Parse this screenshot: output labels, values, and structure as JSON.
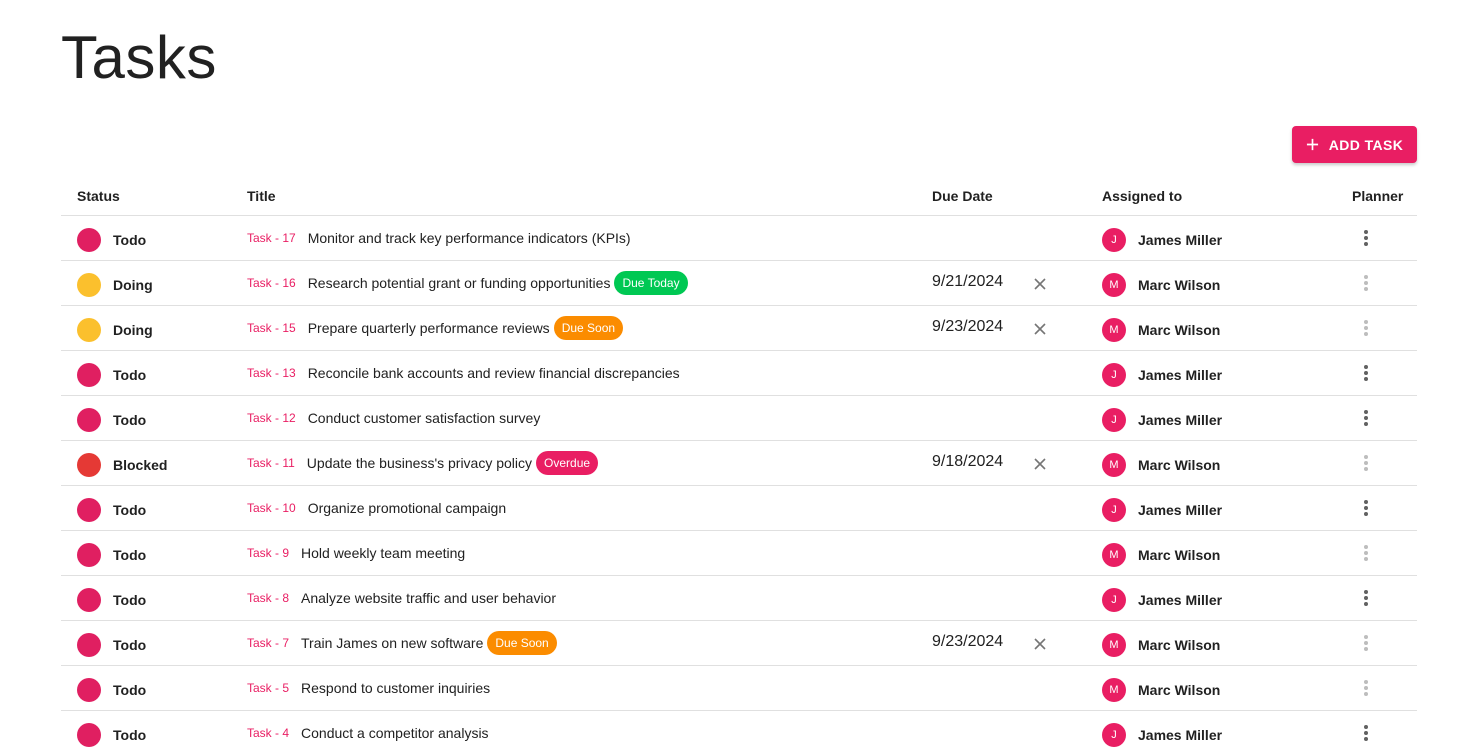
{
  "page": {
    "title": "Tasks",
    "add_button_label": "ADD TASK"
  },
  "colors": {
    "accent": "#e91e63",
    "todo": "#e01f61",
    "doing": "#fbc02d",
    "blocked": "#e53935",
    "due_today": "#00c853",
    "due_soon": "#fb8c00",
    "overdue": "#e91e63",
    "menu_active": "#616161",
    "menu_inactive": "#bdbdbd"
  },
  "table": {
    "headers": {
      "status": "Status",
      "title": "Title",
      "due_date": "Due Date",
      "assigned_to": "Assigned to",
      "planner": "Planner"
    },
    "rows": [
      {
        "status": "Todo",
        "status_color": "#e01f61",
        "task_id": "Task - 17",
        "title": "Monitor and track key performance indicators (KPIs)",
        "badge": "",
        "badge_color": "",
        "due_date": "",
        "clearable": false,
        "avatar": "J",
        "assignee": "James Miller",
        "menu_active": true
      },
      {
        "status": "Doing",
        "status_color": "#fbc02d",
        "task_id": "Task - 16",
        "title": "Research potential grant or funding opportunities",
        "badge": "Due Today",
        "badge_color": "#00c853",
        "due_date": "9/21/2024",
        "clearable": true,
        "avatar": "M",
        "assignee": "Marc Wilson",
        "menu_active": false
      },
      {
        "status": "Doing",
        "status_color": "#fbc02d",
        "task_id": "Task - 15",
        "title": "Prepare quarterly performance reviews",
        "badge": "Due Soon",
        "badge_color": "#fb8c00",
        "due_date": "9/23/2024",
        "clearable": true,
        "avatar": "M",
        "assignee": "Marc Wilson",
        "menu_active": false
      },
      {
        "status": "Todo",
        "status_color": "#e01f61",
        "task_id": "Task - 13",
        "title": "Reconcile bank accounts and review financial discrepancies",
        "badge": "",
        "badge_color": "",
        "due_date": "",
        "clearable": false,
        "avatar": "J",
        "assignee": "James Miller",
        "menu_active": true
      },
      {
        "status": "Todo",
        "status_color": "#e01f61",
        "task_id": "Task - 12",
        "title": "Conduct customer satisfaction survey",
        "badge": "",
        "badge_color": "",
        "due_date": "",
        "clearable": false,
        "avatar": "J",
        "assignee": "James Miller",
        "menu_active": true
      },
      {
        "status": "Blocked",
        "status_color": "#e53935",
        "task_id": "Task - 11",
        "title": "Update the business's privacy policy",
        "badge": "Overdue",
        "badge_color": "#e91e63",
        "due_date": "9/18/2024",
        "clearable": true,
        "avatar": "M",
        "assignee": "Marc Wilson",
        "menu_active": false
      },
      {
        "status": "Todo",
        "status_color": "#e01f61",
        "task_id": "Task - 10",
        "title": "Organize promotional campaign",
        "badge": "",
        "badge_color": "",
        "due_date": "",
        "clearable": false,
        "avatar": "J",
        "assignee": "James Miller",
        "menu_active": true
      },
      {
        "status": "Todo",
        "status_color": "#e01f61",
        "task_id": "Task - 9",
        "title": "Hold weekly team meeting",
        "badge": "",
        "badge_color": "",
        "due_date": "",
        "clearable": false,
        "avatar": "M",
        "assignee": "Marc Wilson",
        "menu_active": false
      },
      {
        "status": "Todo",
        "status_color": "#e01f61",
        "task_id": "Task - 8",
        "title": "Analyze website traffic and user behavior",
        "badge": "",
        "badge_color": "",
        "due_date": "",
        "clearable": false,
        "avatar": "J",
        "assignee": "James Miller",
        "menu_active": true
      },
      {
        "status": "Todo",
        "status_color": "#e01f61",
        "task_id": "Task - 7",
        "title": "Train James on new software",
        "badge": "Due Soon",
        "badge_color": "#fb8c00",
        "due_date": "9/23/2024",
        "clearable": true,
        "avatar": "M",
        "assignee": "Marc Wilson",
        "menu_active": false
      },
      {
        "status": "Todo",
        "status_color": "#e01f61",
        "task_id": "Task - 5",
        "title": "Respond to customer inquiries",
        "badge": "",
        "badge_color": "",
        "due_date": "",
        "clearable": false,
        "avatar": "M",
        "assignee": "Marc Wilson",
        "menu_active": false
      },
      {
        "status": "Todo",
        "status_color": "#e01f61",
        "task_id": "Task - 4",
        "title": "Conduct a competitor analysis",
        "badge": "",
        "badge_color": "",
        "due_date": "",
        "clearable": false,
        "avatar": "J",
        "assignee": "James Miller",
        "menu_active": true
      }
    ]
  }
}
